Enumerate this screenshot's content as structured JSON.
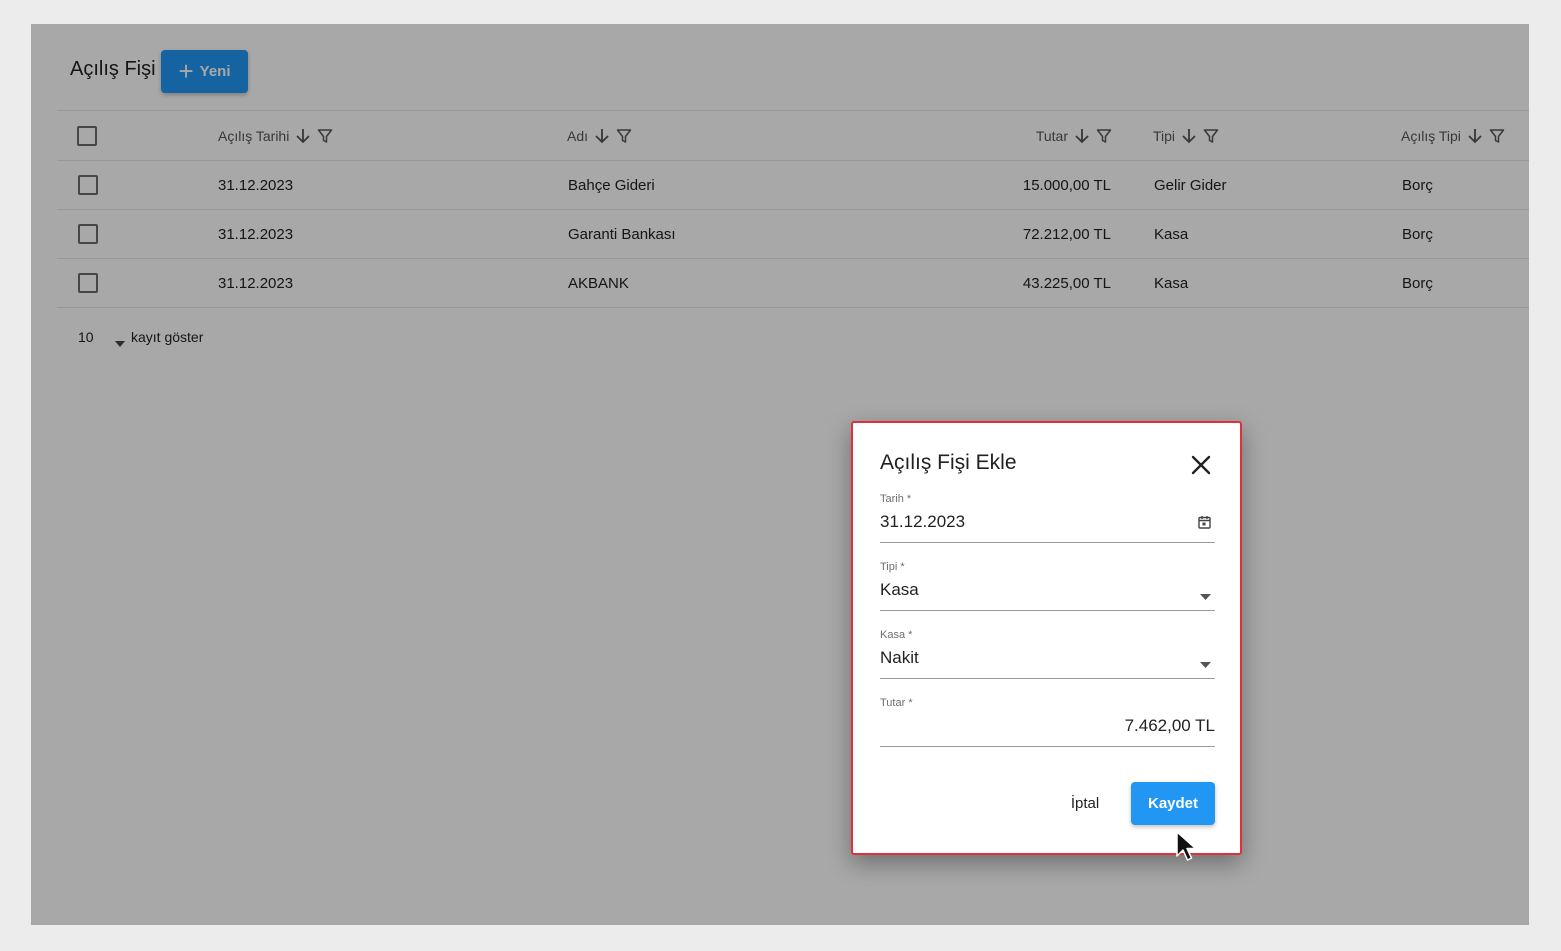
{
  "page": {
    "title": "Açılış Fişi",
    "new_button_label": "Yeni"
  },
  "table": {
    "columns": [
      {
        "label": "Açılış Tarihi"
      },
      {
        "label": "Adı"
      },
      {
        "label": "Tutar"
      },
      {
        "label": "Tipi"
      },
      {
        "label": "Açılış Tipi"
      }
    ],
    "rows": [
      {
        "date": "31.12.2023",
        "name": "Bahçe Gideri",
        "amount": "15.000,00 TL",
        "type": "Gelir Gider",
        "opening_type": "Borç"
      },
      {
        "date": "31.12.2023",
        "name": "Garanti Bankası",
        "amount": "72.212,00 TL",
        "type": "Kasa",
        "opening_type": "Borç"
      },
      {
        "date": "31.12.2023",
        "name": "AKBANK",
        "amount": "43.225,00 TL",
        "type": "Kasa",
        "opening_type": "Borç"
      }
    ],
    "footer": {
      "page_size": "10",
      "page_size_label": "kayıt göster"
    }
  },
  "dialog": {
    "title": "Açılış Fişi Ekle",
    "fields": {
      "date": {
        "label": "Tarih *",
        "value": "31.12.2023"
      },
      "type": {
        "label": "Tipi *",
        "value": "Kasa"
      },
      "cash": {
        "label": "Kasa *",
        "value": "Nakit"
      },
      "amount": {
        "label": "Tutar *",
        "value": "7.462,00 TL"
      }
    },
    "cancel_label": "İptal",
    "save_label": "Kaydet"
  },
  "colors": {
    "primary": "#2196f3",
    "dialog_border": "#e0303c",
    "overlay": "rgba(0,0,0,0.34)"
  },
  "icons": [
    "plus-icon",
    "sort-down-icon",
    "filter-icon",
    "calendar-icon",
    "chevron-down-icon",
    "close-icon",
    "mouse-cursor-icon"
  ]
}
